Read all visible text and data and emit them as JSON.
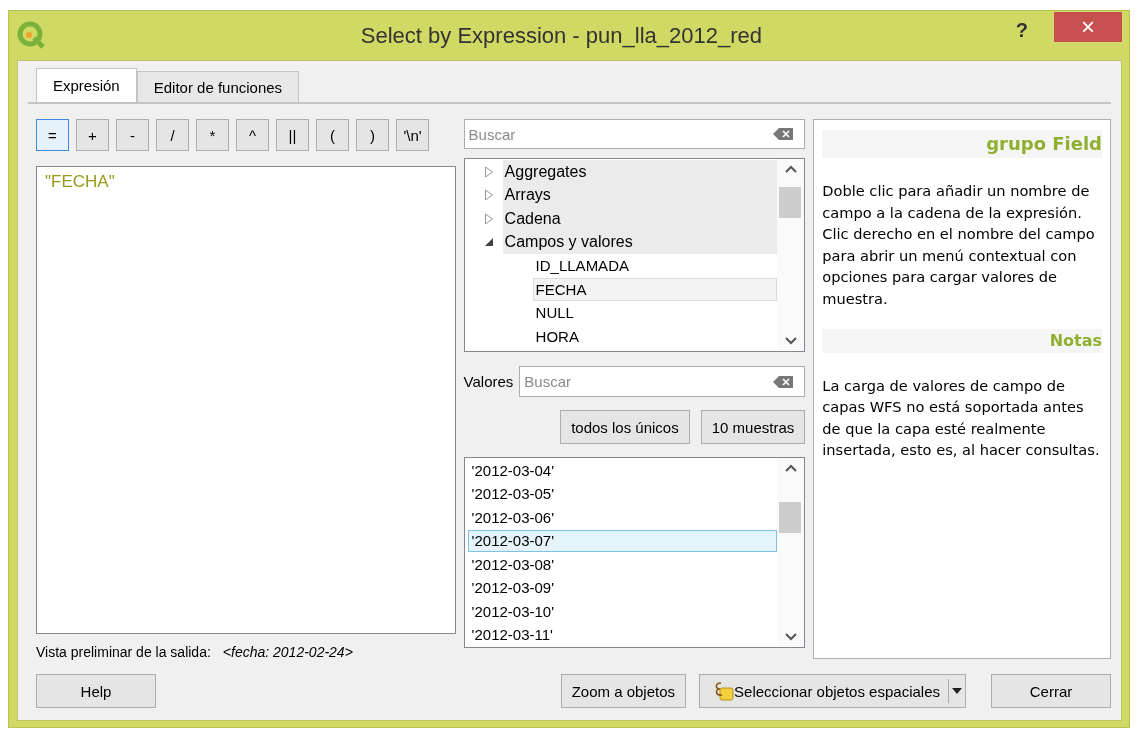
{
  "window": {
    "title": "Select by Expression - pun_lla_2012_red",
    "help_glyph": "?",
    "close_glyph": "×"
  },
  "tabs": [
    {
      "label": "Expresión",
      "selected": true
    },
    {
      "label": "Editor de funciones",
      "selected": false
    }
  ],
  "operators": [
    {
      "label": "=",
      "selected": true
    },
    {
      "label": "+",
      "selected": false
    },
    {
      "label": "-",
      "selected": false
    },
    {
      "label": "/",
      "selected": false
    },
    {
      "label": "*",
      "selected": false
    },
    {
      "label": "^",
      "selected": false
    },
    {
      "label": "||",
      "selected": false
    },
    {
      "label": "(",
      "selected": false
    },
    {
      "label": ")",
      "selected": false
    },
    {
      "label": "'\\n'",
      "selected": false
    }
  ],
  "expression": {
    "value": "\"FECHA\""
  },
  "function_search": {
    "placeholder": "Buscar"
  },
  "function_tree": [
    {
      "label": "Aggregates",
      "expanded": false
    },
    {
      "label": "Arrays",
      "expanded": false
    },
    {
      "label": "Cadena",
      "expanded": false
    },
    {
      "label": "Campos y valores",
      "expanded": true,
      "children": [
        {
          "label": "ID_LLAMADA",
          "selected": false
        },
        {
          "label": "FECHA",
          "selected": true
        },
        {
          "label": "NULL",
          "selected": false
        },
        {
          "label": "HORA",
          "selected": false
        }
      ]
    }
  ],
  "values_label": "Valores",
  "values_search": {
    "placeholder": "Buscar"
  },
  "value_buttons": [
    "todos los únicos",
    "10 muestras"
  ],
  "values": [
    {
      "label": "'2012-03-04'",
      "selected": false
    },
    {
      "label": "'2012-03-05'",
      "selected": false
    },
    {
      "label": "'2012-03-06'",
      "selected": false
    },
    {
      "label": "'2012-03-07'",
      "selected": true
    },
    {
      "label": "'2012-03-08'",
      "selected": false
    },
    {
      "label": "'2012-03-09'",
      "selected": false
    },
    {
      "label": "'2012-03-10'",
      "selected": false
    },
    {
      "label": "'2012-03-11'",
      "selected": false
    }
  ],
  "help_panel": {
    "heading": "grupo Field",
    "paragraphs": [
      "Doble clic para añadir un nombre de campo a la cadena de la expresión.",
      "Clic derecho en el nombre del campo para abrir un menú contextual con opciones para cargar valores de muestra."
    ],
    "notes_heading": "Notas",
    "notes_paragraphs": [
      "La carga de valores de campo de capas WFS no está soportada antes de que la capa esté realmente insertada, esto es, al hacer consultas."
    ]
  },
  "preview": {
    "label": "Vista preliminar de la salida:",
    "value": "<fecha: 2012-02-24>"
  },
  "buttons": [
    {
      "label": "Help",
      "kind": "plain"
    },
    {
      "label": "Zoom a objetos",
      "kind": "plain"
    },
    {
      "label": "Seleccionar objetos espaciales",
      "kind": "split"
    },
    {
      "label": "Cerrar",
      "kind": "plain"
    }
  ]
}
